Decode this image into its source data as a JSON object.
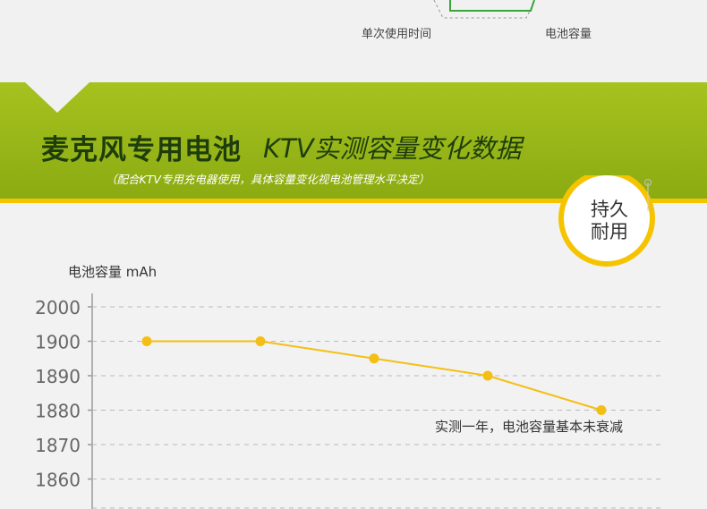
{
  "top": {
    "labels": [
      "单次使用时间",
      "电池容量"
    ]
  },
  "banner": {
    "title": "麦克风专用电池",
    "subtitle": "KTV实测容量变化数据",
    "note": "（配合KTV专用充电器使用，具体容量变化视电池管理水平决定）",
    "badge_line1": "持久",
    "badge_line2": "耐用"
  },
  "colors": {
    "banner_green": "#9bb918",
    "title_dark_green": "#1e3d0c",
    "accent_yellow": "#f5c400",
    "series_yellow": "#f4bf14",
    "axis_gray": "#999999",
    "grid_gray": "#bbbbbb"
  },
  "chart_data": {
    "type": "line",
    "ylabel": "电池容量 mAh",
    "y_ticks": [
      2000,
      1900,
      1890,
      1880,
      1870,
      1860
    ],
    "y_scale": "categorical-spaced",
    "grid": "dashed-horizontal",
    "series": [
      {
        "values": [
          1900,
          1900,
          1895,
          1890,
          1880
        ]
      }
    ],
    "annotation": "实测一年，电池容量基本未衰减"
  }
}
